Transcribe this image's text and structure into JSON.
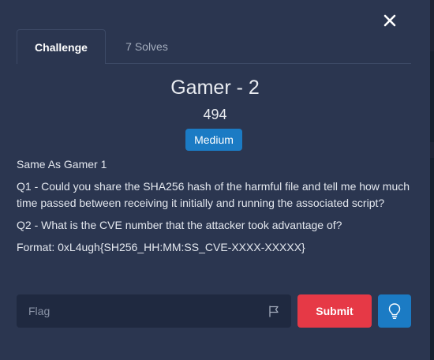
{
  "tabs": [
    {
      "label": "Challenge",
      "active": true
    },
    {
      "label": "7 Solves",
      "active": false
    }
  ],
  "challenge": {
    "name": "Gamer - 2",
    "points": "494",
    "difficulty": "Medium",
    "description": [
      "Same As Gamer 1",
      "Q1 - Could you share the SHA256 hash of the harmful file and tell me how much time passed between receiving it initially and running the associated script?",
      "Q2 - What is the CVE number that the attacker took advantage of?",
      "Format: 0xL4ugh{SH256_HH:MM:SS_CVE-XXXX-XXXXX}"
    ]
  },
  "flag_form": {
    "placeholder": "Flag",
    "value": "",
    "submit_label": "Submit"
  },
  "icons": {
    "close": "close-icon",
    "flag": "flag-icon",
    "hint": "lightbulb-icon"
  },
  "colors": {
    "background": "#2b3650",
    "submit": "#e63946",
    "accent": "#1b7bc4"
  }
}
